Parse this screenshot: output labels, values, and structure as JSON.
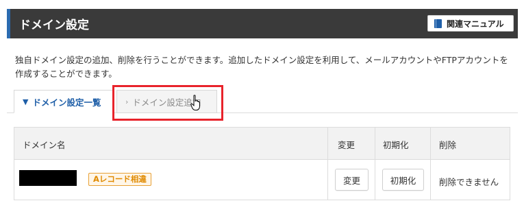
{
  "header": {
    "title": "ドメイン設定",
    "manual_button_label": "関連マニュアル",
    "manual_icon": "book-icon"
  },
  "description": "独自ドメイン設定の追加、削除を行うことができます。追加したドメイン設定を利用して、メールアカウントやFTPアカウントを作成することができます。",
  "tabs": [
    {
      "label": "ドメイン設定一覧",
      "icon": "chevron-down-icon",
      "active": true
    },
    {
      "label": "ドメイン設定追加",
      "icon": "chevron-right-icon",
      "active": false
    }
  ],
  "table": {
    "columns": [
      "ドメイン名",
      "変更",
      "初期化",
      "削除"
    ],
    "rows": [
      {
        "domain": "",
        "badge": "Aレコード相違",
        "change_label": "変更",
        "init_label": "初期化",
        "delete_text": "削除できません"
      }
    ]
  },
  "colors": {
    "header_bg": "#3a3a3a",
    "accent_blue": "#1f5fa8",
    "highlight_red": "#e8232b",
    "badge_orange": "#e08a00"
  }
}
